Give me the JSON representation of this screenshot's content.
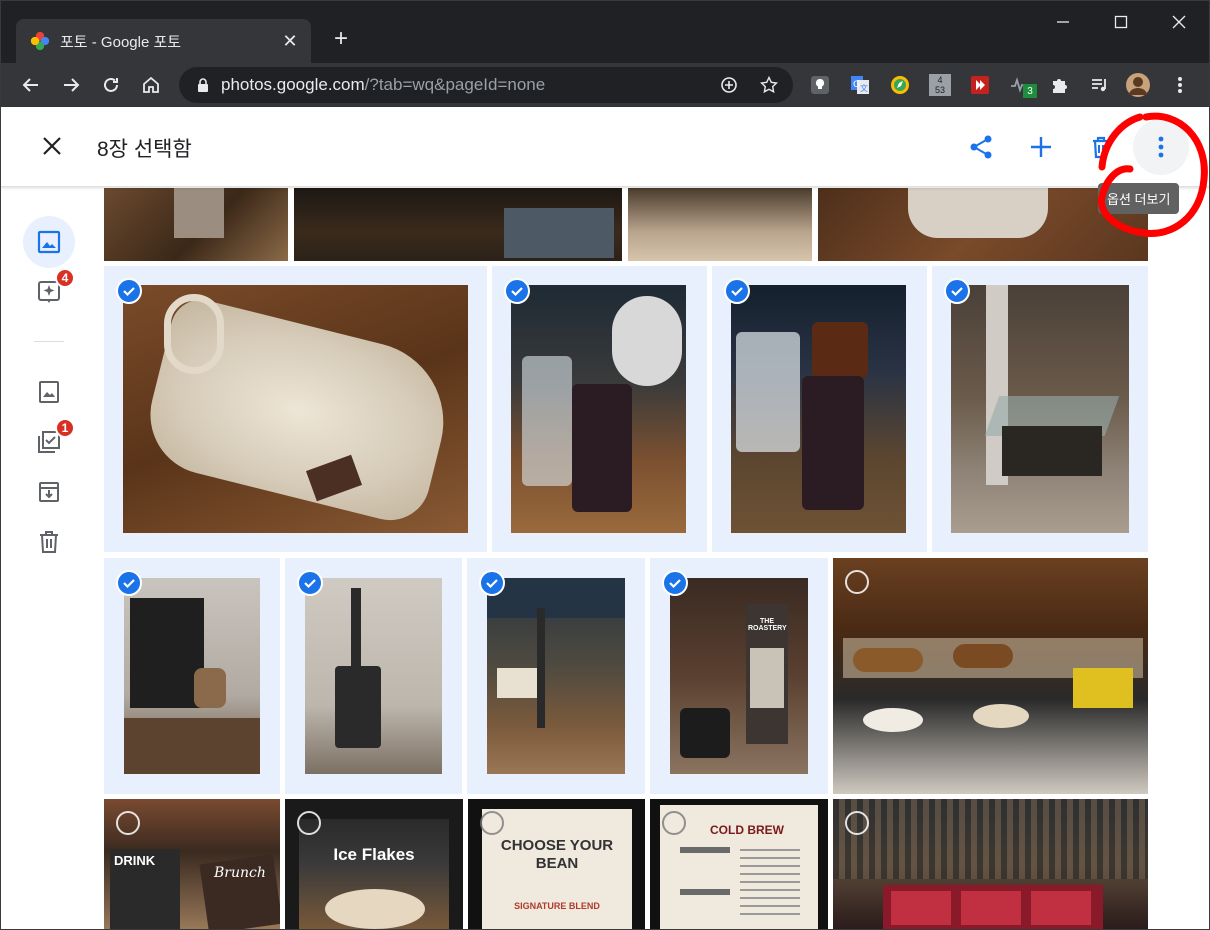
{
  "browser": {
    "tab_title": "포토 - Google 포토",
    "url_host": "photos.google.com",
    "url_rest": "/?tab=wq&pageId=none",
    "ext_badges": {
      "counter": "4\n53",
      "green": "3"
    }
  },
  "header": {
    "title": "8장 선택함",
    "tooltip": "옵션 더보기",
    "annotation_color": "#ff0000"
  },
  "sidebar": {
    "badges": {
      "assistant": "4",
      "utilities": "1"
    }
  },
  "photos": {
    "sign_texts": {
      "drink": "DRINK",
      "brunch": "Brunch",
      "ice": "Ice Flakes",
      "choose": "CHOOSE YOUR BEAN",
      "signature": "SIGNATURE BLEND",
      "coldbrew": "COLD BREW",
      "roastery": "THE ROASTERY"
    }
  },
  "colors": {
    "accent": "#1a73e8",
    "selected_bg": "#e8f0fe",
    "badge": "#d93025",
    "chrome_dark": "#202124",
    "chrome_toolbar": "#35363a"
  }
}
